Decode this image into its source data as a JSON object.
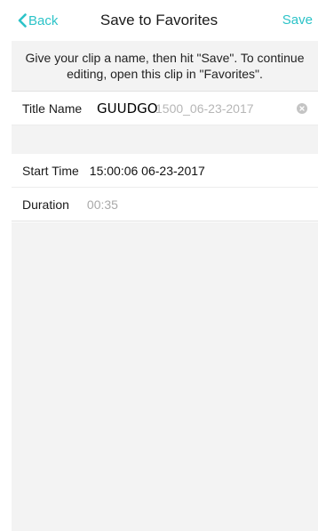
{
  "nav": {
    "back_label": "Back",
    "title": "Save to Favorites",
    "save_label": "Save"
  },
  "info_text": "Give your clip a name, then hit \"Save\". To continue editing, open this clip in \"Favorites\".",
  "title_row": {
    "label": "Title Name",
    "value": "GUUDGO",
    "placeholder": "1500_06-23-2017"
  },
  "start_row": {
    "label": "Start Time",
    "value": "15:00:06 06-23-2017"
  },
  "duration_row": {
    "label": "Duration",
    "value": "00:35"
  },
  "colors": {
    "accent": "#2cc3c8",
    "background_gray": "#f3f3f3"
  },
  "icons": {
    "back": "chevron-left-icon",
    "clear": "clear-circle-icon"
  }
}
